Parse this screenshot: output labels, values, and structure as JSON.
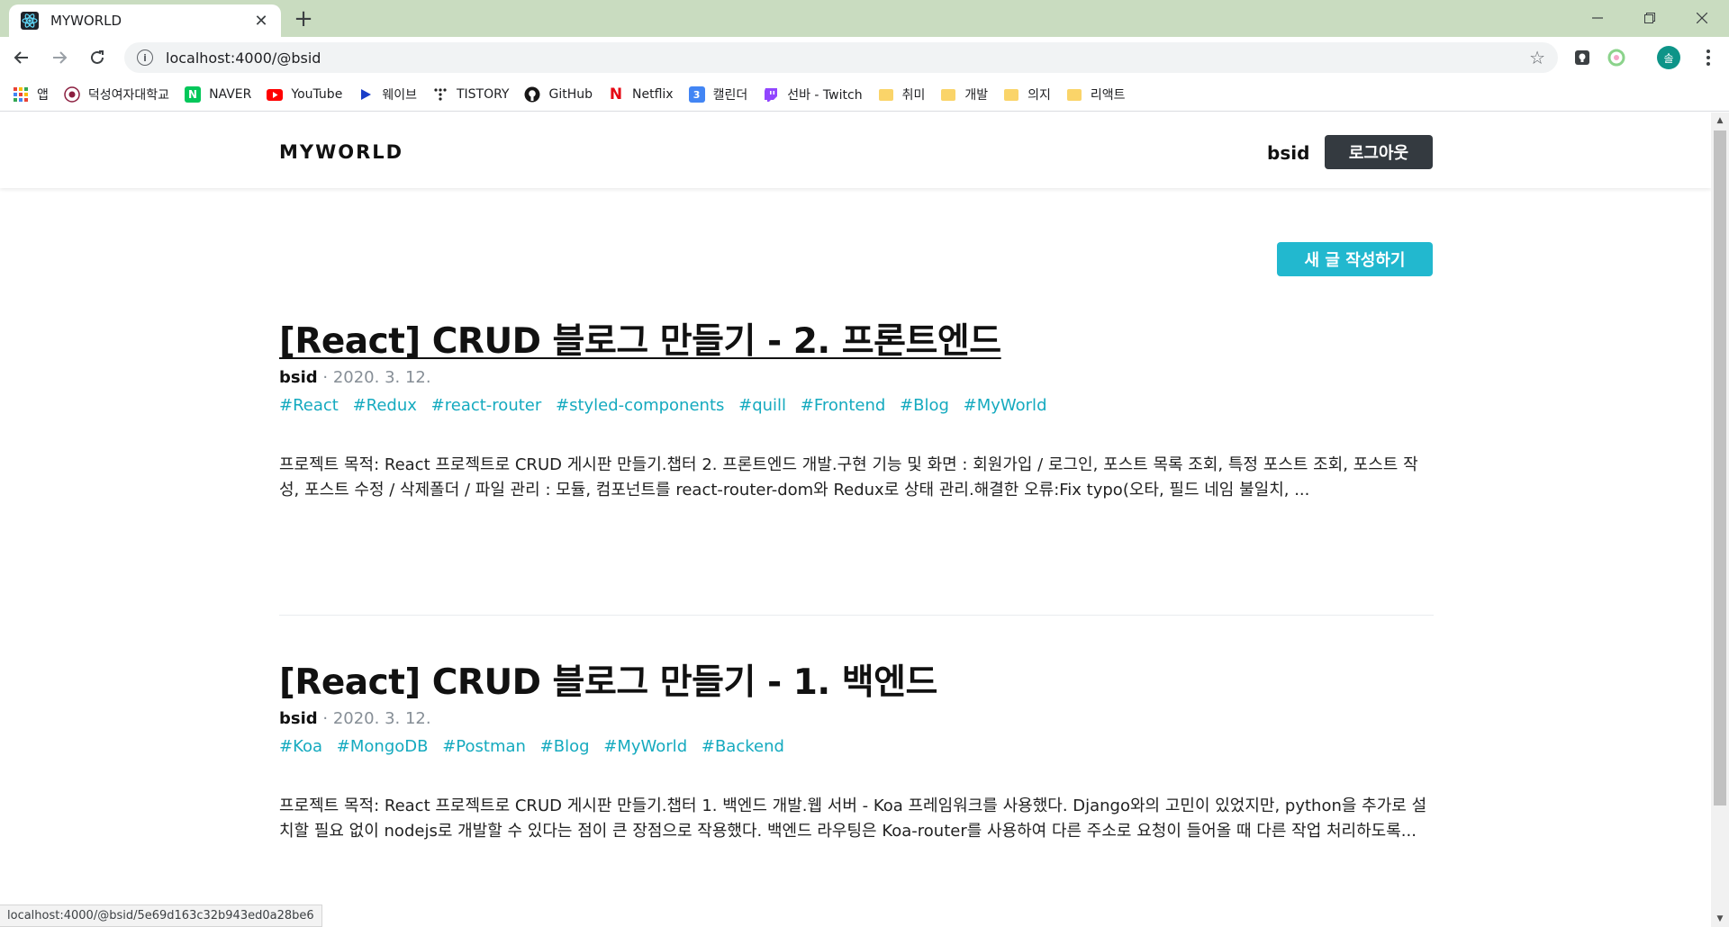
{
  "browser": {
    "tab_title": "MYWORLD",
    "tab_close": "✕",
    "new_tab": "+",
    "url": "localhost:4000/@bsid",
    "profile_initial": "솔",
    "bookmarks": [
      {
        "label": "앱",
        "icon": "apps-grid-icon"
      },
      {
        "label": "덕성여자대학교",
        "icon": "university-seal-icon"
      },
      {
        "label": "NAVER",
        "icon": "naver-icon"
      },
      {
        "label": "YouTube",
        "icon": "youtube-icon"
      },
      {
        "label": "웨이브",
        "icon": "wavve-icon"
      },
      {
        "label": "TISTORY",
        "icon": "tistory-icon"
      },
      {
        "label": "GitHub",
        "icon": "github-icon"
      },
      {
        "label": "Netflix",
        "icon": "netflix-icon"
      },
      {
        "label": "캘린더",
        "icon": "calendar-icon"
      },
      {
        "label": "선바 - Twitch",
        "icon": "twitch-icon"
      },
      {
        "label": "취미",
        "icon": "folder-icon"
      },
      {
        "label": "개발",
        "icon": "folder-icon"
      },
      {
        "label": "의지",
        "icon": "folder-icon"
      },
      {
        "label": "리액트",
        "icon": "folder-icon"
      }
    ],
    "calendar_day": "3",
    "status_url": "localhost:4000/@bsid/5e69d163c32b943ed0a28be6"
  },
  "site": {
    "logo": "MYWORLD",
    "username": "bsid",
    "logout_label": "로그아웃",
    "write_label": "새 글 작성하기"
  },
  "posts": [
    {
      "title": "[React] CRUD 블로그 만들기 - 2. 프론트엔드",
      "author": "bsid",
      "separator": " · ",
      "date": "2020. 3. 12.",
      "tags": [
        "#React",
        "#Redux",
        "#react-router",
        "#styled-components",
        "#quill",
        "#Frontend",
        "#Blog",
        "#MyWorld"
      ],
      "excerpt": "프로젝트 목적: React 프로젝트로 CRUD 게시판 만들기.챕터 2. 프론트엔드 개발.구현 기능 및 화면 : 회원가입 / 로그인, 포스트 목록 조회, 특정 포스트 조회, 포스트 작성, 포스트 수정 / 삭제폴더 / 파일 관리 : 모듈, 컴포넌트를 react-router-dom와 Redux로 상태 관리.해결한 오류:Fix typo(오타, 필드 네임 불일치, ..."
    },
    {
      "title": "[React] CRUD 블로그 만들기 - 1. 백엔드",
      "author": "bsid",
      "separator": " · ",
      "date": "2020. 3. 12.",
      "tags": [
        "#Koa",
        "#MongoDB",
        "#Postman",
        "#Blog",
        "#MyWorld",
        "#Backend"
      ],
      "excerpt": "프로젝트 목적: React 프로젝트로 CRUD 게시판 만들기.챕터 1. 백엔드 개발.웹 서버 - Koa 프레임워크를 사용했다. Django와의 고민이 있었지만, python을 추가로 설치할 필요 없이 nodejs로 개발할 수 있다는 점이 큰 장점으로 작용했다. 백엔드 라우팅은 Koa-router를 사용하여 다른 주소로 요청이 들어올 때 다른 작업 처리하도록..."
    }
  ]
}
